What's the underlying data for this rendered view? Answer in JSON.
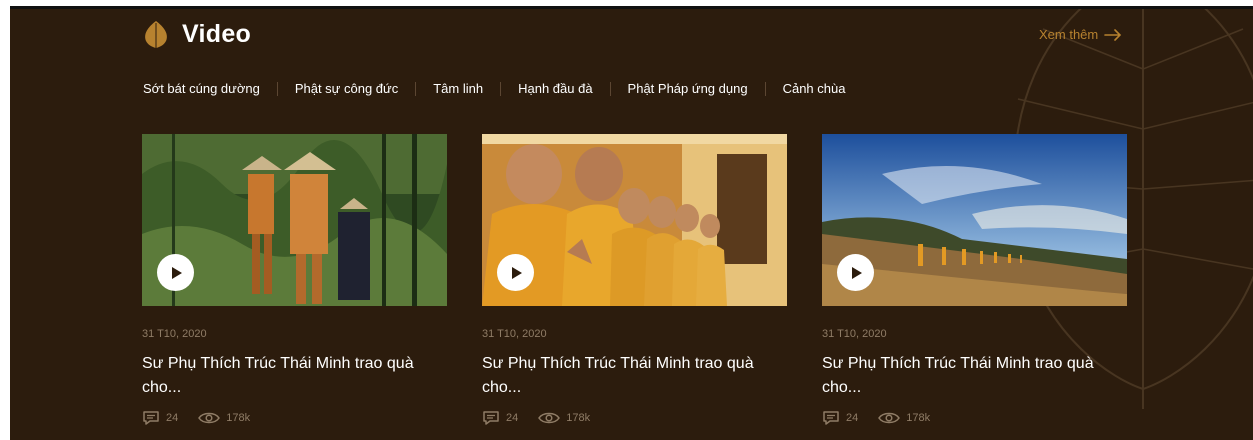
{
  "section": {
    "title": "Video",
    "more_label": "Xem thêm",
    "logo_icon": "bodhi-leaf-icon"
  },
  "categories": [
    "Sớt bát cúng dường",
    "Phật sự công đức",
    "Tâm linh",
    "Hạnh đầu đà",
    "Phật Pháp ứng dụng",
    "Cảnh chùa"
  ],
  "videos": [
    {
      "date": "31 T10, 2020",
      "title": "Sư Phụ Thích Trúc Thái Minh trao quà cho...",
      "comments": "24",
      "views": "178k"
    },
    {
      "date": "31 T10, 2020",
      "title": "Sư Phụ Thích Trúc Thái Minh trao quà cho...",
      "comments": "24",
      "views": "178k"
    },
    {
      "date": "31 T10, 2020",
      "title": "Sư Phụ Thích Trúc Thái Minh trao quà cho...",
      "comments": "24",
      "views": "178k"
    }
  ],
  "colors": {
    "background": "#2c1c0d",
    "accent": "#b7822f",
    "muted": "#8f7c66",
    "text": "#ffffff"
  }
}
